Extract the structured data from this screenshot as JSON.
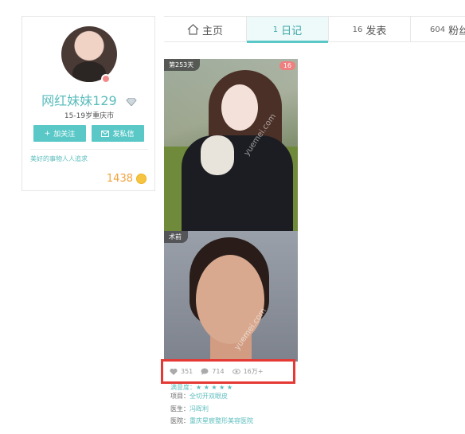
{
  "profile": {
    "username": "网红妹妹129",
    "meta": "15-19岁重庆市",
    "follow_label": "加关注",
    "message_label": "发私信",
    "bio": "美好的事物人人追求",
    "points": "1438"
  },
  "tabs": {
    "home": "主页",
    "diary_count": "1",
    "diary": "日记",
    "posts_count": "16",
    "posts": "发表",
    "fans_count": "604",
    "fans": "粉丝"
  },
  "diary": {
    "day_tag": "第253天",
    "image_count": "16",
    "before_tag": "术前",
    "watermark": "yuemei.com",
    "likes": "351",
    "comments": "714",
    "views": "16万+",
    "rating_label": "满意度：",
    "rating_stars": "★ ★ ★ ★ ★",
    "project_label": "项目：",
    "project_value": "全切开双眼皮",
    "doctor_label": "医生：",
    "doctor_value": "冯晖利",
    "hospital_label": "医院：",
    "hospital_value": "重庆星宸整形美容医院"
  },
  "colors": {
    "accent": "#5bc8c8",
    "highlight_box": "#e53935",
    "points": "#f3a13d"
  }
}
